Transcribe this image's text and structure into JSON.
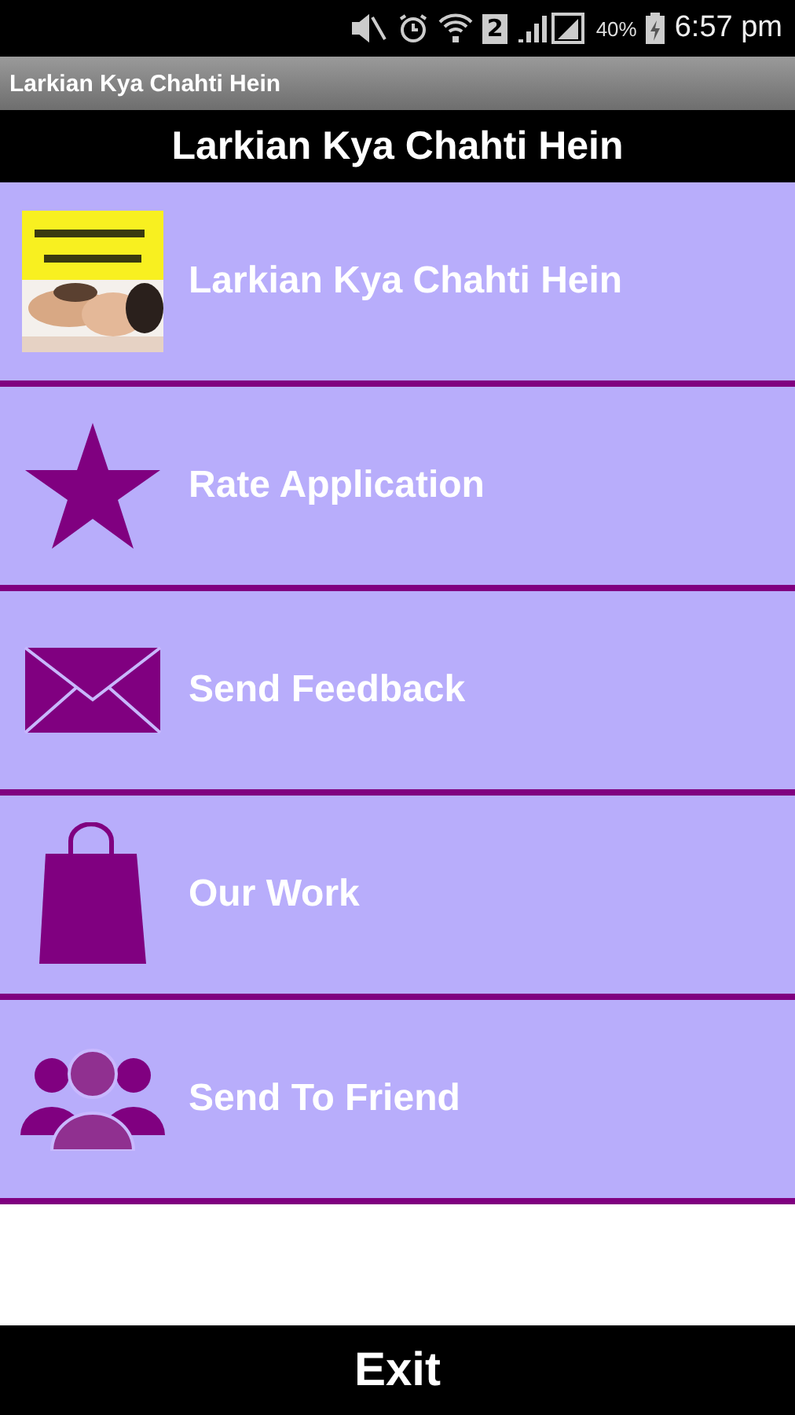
{
  "status_bar": {
    "sim_badge": "2",
    "battery": "40%",
    "time": "6:57 pm"
  },
  "app_bar": {
    "title": "Larkian Kya Chahti Hein"
  },
  "header": {
    "title": "Larkian Kya Chahti Hein"
  },
  "menu": [
    {
      "kind": "picture",
      "label": "Larkian Kya Chahti Hein"
    },
    {
      "kind": "star",
      "label": "Rate Application"
    },
    {
      "kind": "mail",
      "label": "Send Feedback"
    },
    {
      "kind": "bag",
      "label": "Our Work"
    },
    {
      "kind": "people",
      "label": "Send To Friend"
    }
  ],
  "exit_button": "Exit"
}
